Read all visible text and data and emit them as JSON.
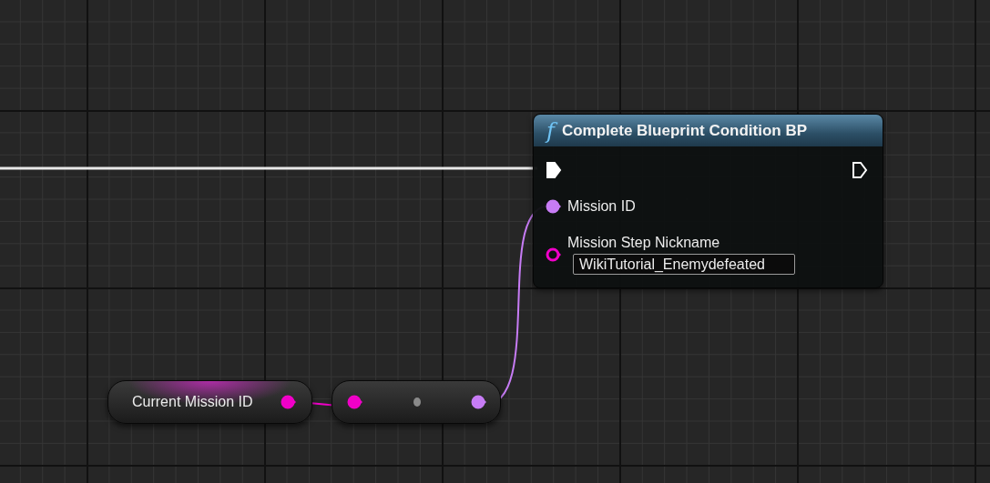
{
  "function_node": {
    "icon": "f",
    "title": "Complete Blueprint Condition BP",
    "exec": {
      "in_connected": true,
      "out_connected": false
    },
    "pins": [
      {
        "label": "Mission ID",
        "color": "#c77cf5",
        "connected": true
      },
      {
        "label": "Mission Step Nickname",
        "color": "#f000c8",
        "connected": false,
        "value": "WikiTutorial_Enemydefeated"
      }
    ]
  },
  "variable_node": {
    "label": "Current Mission ID",
    "pin": {
      "color": "#f000c8",
      "connected": true
    }
  },
  "convert_node": {
    "pins": [
      {
        "color": "#f000c8"
      },
      {
        "color": "#c77cf5"
      }
    ]
  }
}
